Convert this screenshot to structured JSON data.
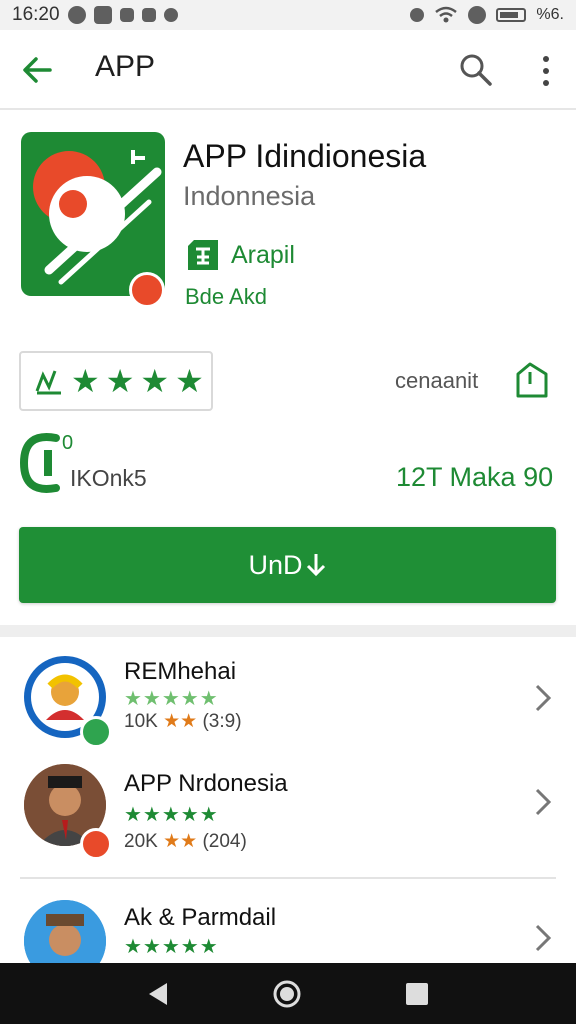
{
  "status_bar": {
    "time": "16:20",
    "battery_text": "%6."
  },
  "app_bar": {
    "title": "APP"
  },
  "app": {
    "name": "APP Idindionesia",
    "developer": "Indonnesia",
    "badge_label": "Arapil",
    "badge_sub": "Bde Akd"
  },
  "rating": {
    "stars_count": 4,
    "label": "cenaanit"
  },
  "stats": {
    "left_sup": "0",
    "left_label": "IKOnk5",
    "right_label": "12T Maka 90"
  },
  "install_button": {
    "label": "UnD"
  },
  "list": {
    "items": [
      {
        "title": "REMhehai",
        "stars": "★★★★★",
        "meta_count": "10K",
        "meta_stars": "★★",
        "meta_paren": "(3:9)"
      },
      {
        "title": "APP Nrdonesia",
        "stars": "★★★★★",
        "meta_count": "20K",
        "meta_stars": "★★",
        "meta_paren": "(204)"
      },
      {
        "title": "Ak & Parmdail",
        "stars": "★★★★★",
        "meta_count": "",
        "meta_stars": "",
        "meta_paren": ""
      }
    ]
  },
  "colors": {
    "accent": "#1f8f36",
    "star_orange": "#e07b1a",
    "nav_bg": "#111111"
  }
}
